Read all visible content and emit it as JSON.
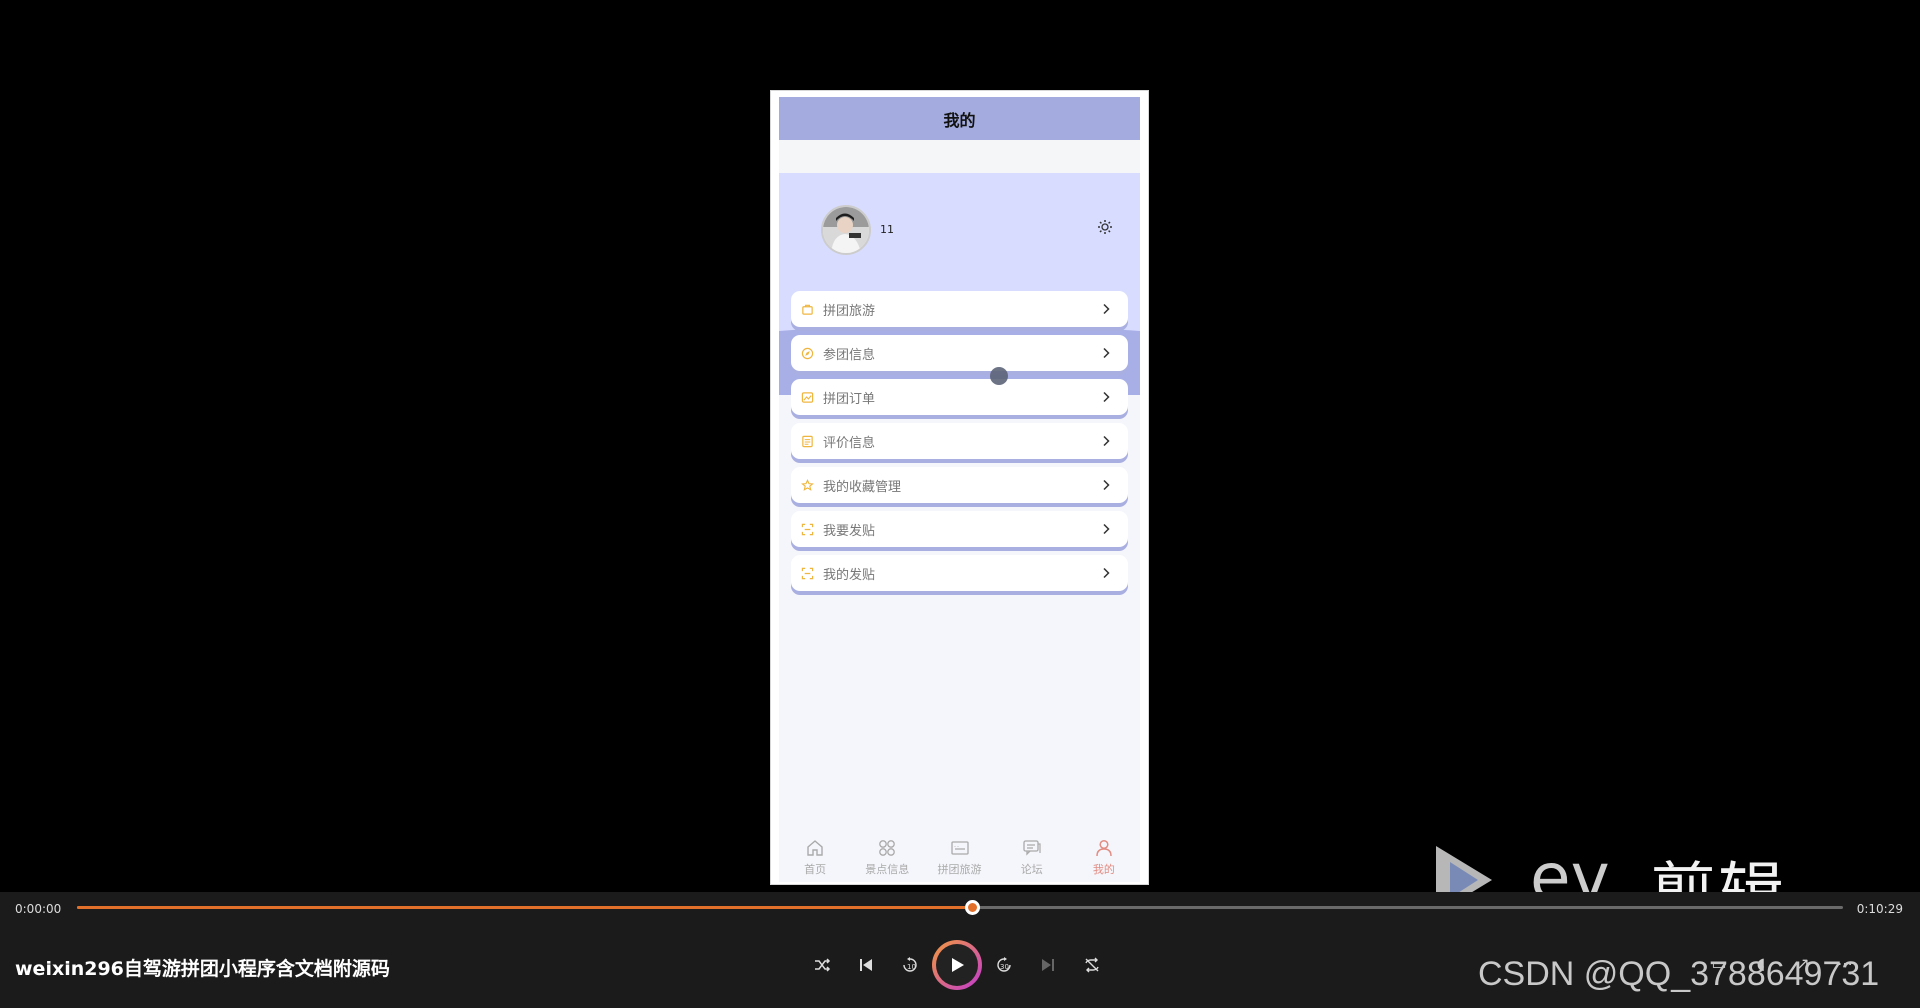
{
  "phone": {
    "nav_title": "我的",
    "username": "11",
    "settings_icon": "gear-icon",
    "menu": [
      {
        "label": "拼团旅游",
        "icon": "bag-icon"
      },
      {
        "label": "参团信息",
        "icon": "compass-icon"
      },
      {
        "label": "拼团订单",
        "icon": "image-icon"
      },
      {
        "label": "评价信息",
        "icon": "list-icon"
      },
      {
        "label": "我的收藏管理",
        "icon": "star-icon"
      },
      {
        "label": "我要发贴",
        "icon": "scan-icon"
      },
      {
        "label": "我的发贴",
        "icon": "scan-icon"
      }
    ],
    "tabs": [
      {
        "label": "首页",
        "icon": "home-icon"
      },
      {
        "label": "景点信息",
        "icon": "grid-icon"
      },
      {
        "label": "拼团旅游",
        "icon": "ticket-icon"
      },
      {
        "label": "论坛",
        "icon": "chat-icon"
      },
      {
        "label": "我的",
        "icon": "user-icon"
      }
    ],
    "active_tab": 4
  },
  "player": {
    "time_current": "0:00:00",
    "time_total": "0:10:29",
    "progress": 0.507,
    "title": "weixin296自驾游拼团小程序含文档附源码",
    "accent": "#e2702b"
  },
  "watermark": {
    "ev_text": "剪辑",
    "csdn_text": "CSDN @QQ_3788649731"
  }
}
